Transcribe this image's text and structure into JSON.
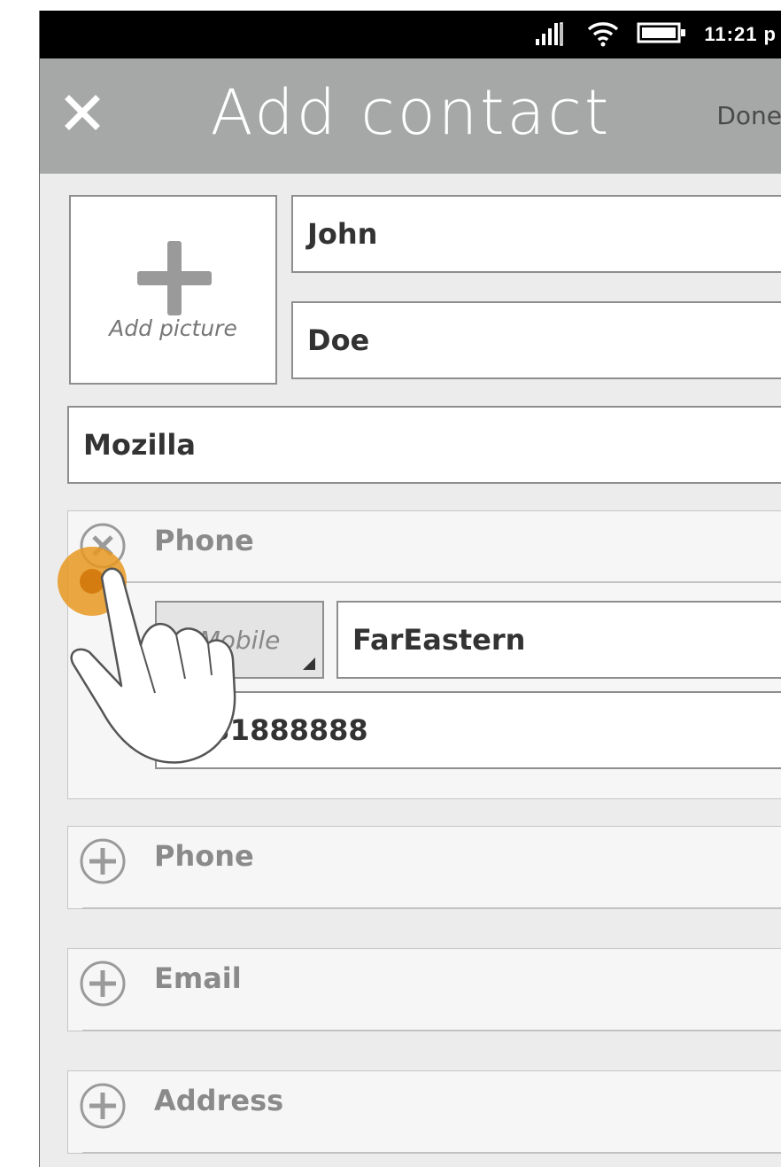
{
  "statusbar": {
    "time": "11:21 p",
    "icons": [
      "signal-icon",
      "wifi-icon",
      "battery-icon"
    ]
  },
  "header": {
    "title": "Add contact",
    "close_icon": "close-icon",
    "done_label": "Done"
  },
  "picture": {
    "label": "Add picture",
    "icon": "plus-icon"
  },
  "form": {
    "first_name": "John",
    "last_name": "Doe",
    "company": "Mozilla"
  },
  "phone_section": {
    "label": "Phone",
    "icon": "remove-icon",
    "type_value": "Mobile",
    "carrier": "FarEastern",
    "number": "0931888888"
  },
  "add_sections": [
    {
      "label": "Phone",
      "icon": "add-icon"
    },
    {
      "label": "Email",
      "icon": "add-icon"
    },
    {
      "label": "Address",
      "icon": "add-icon"
    }
  ],
  "colors": {
    "header_bg": "#a6a8a7",
    "touch_indicator": "#e89820",
    "page_bg": "#ececec"
  }
}
